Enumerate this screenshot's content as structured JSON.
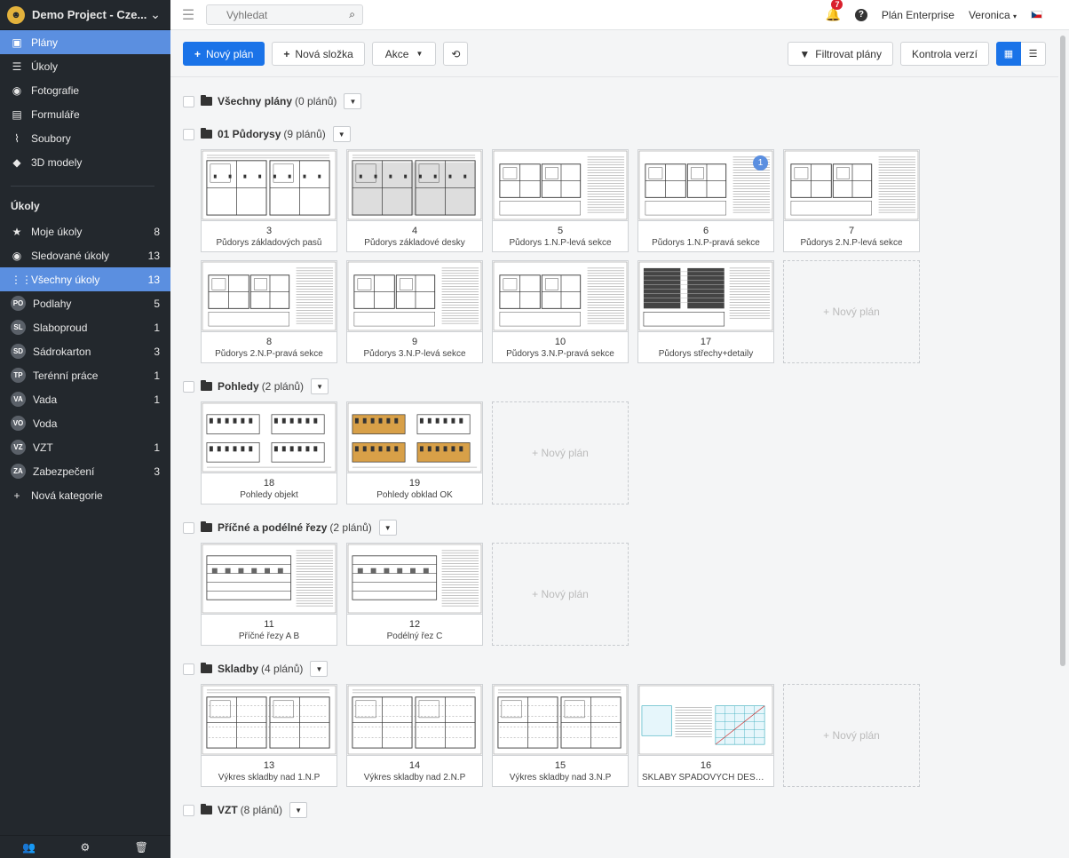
{
  "project": {
    "name": "Demo Project - Cze...",
    "logo_icon": "project-logo-icon"
  },
  "nav": [
    {
      "label": "Plány",
      "icon": "plans-icon",
      "active": true
    },
    {
      "label": "Úkoly",
      "icon": "list-icon"
    },
    {
      "label": "Fotografie",
      "icon": "camera-icon"
    },
    {
      "label": "Formuláře",
      "icon": "clipboard-icon"
    },
    {
      "label": "Soubory",
      "icon": "paperclip-icon"
    },
    {
      "label": "3D modely",
      "icon": "cube-icon"
    }
  ],
  "tasks_section": {
    "title": "Úkoly",
    "items": [
      {
        "label": "Moje úkoly",
        "icon": "star-icon",
        "count": "8"
      },
      {
        "label": "Sledované úkoly",
        "icon": "eye-icon",
        "count": "13"
      },
      {
        "label": "Všechny úkoly",
        "icon": "grid-icon",
        "count": "13",
        "active": true
      },
      {
        "label": "Podlahy",
        "badge": "PO",
        "count": "5"
      },
      {
        "label": "Slaboproud",
        "badge": "SL",
        "count": "1"
      },
      {
        "label": "Sádrokarton",
        "badge": "SD",
        "count": "3"
      },
      {
        "label": "Terénní práce",
        "badge": "TP",
        "count": "1"
      },
      {
        "label": "Vada",
        "badge": "VA",
        "count": "1"
      },
      {
        "label": "Voda",
        "badge": "VO",
        "count": ""
      },
      {
        "label": "VZT",
        "badge": "VZ",
        "count": "1"
      },
      {
        "label": "Zabezpečení",
        "badge": "ZA",
        "count": "3"
      }
    ],
    "new_category": "Nová kategorie"
  },
  "topbar": {
    "search_placeholder": "Vyhledat",
    "notifications": "7",
    "plan": "Plán Enterprise",
    "user": "Veronica"
  },
  "toolbar": {
    "new_plan": "Nový plán",
    "new_folder": "Nová složka",
    "actions": "Akce",
    "filter": "Filtrovat plány",
    "version_check": "Kontrola verzí"
  },
  "new_plan_tile": "+ Nový plán",
  "folders": [
    {
      "name": "Všechny plány",
      "count": "(0 plánů)",
      "plans": [],
      "new_tile": false
    },
    {
      "name": "01 Půdorysy",
      "count": "(9 plánů)",
      "new_tile": true,
      "plans": [
        {
          "num": "3",
          "title": "Půdorys základových pasů",
          "kind": "foundation"
        },
        {
          "num": "4",
          "title": "Půdorys základové desky",
          "kind": "slab"
        },
        {
          "num": "5",
          "title": "Půdorys 1.N.P-levá sekce",
          "kind": "floor"
        },
        {
          "num": "6",
          "title": "Půdorys 1.N.P-pravá sekce",
          "kind": "floor",
          "pin": "1"
        },
        {
          "num": "7",
          "title": "Půdorys 2.N.P-levá sekce",
          "kind": "floor"
        },
        {
          "num": "8",
          "title": "Půdorys 2.N.P-pravá sekce",
          "kind": "floor"
        },
        {
          "num": "9",
          "title": "Půdorys 3.N.P-levá sekce",
          "kind": "floor"
        },
        {
          "num": "10",
          "title": "Půdorys 3.N.P-pravá sekce",
          "kind": "floor"
        },
        {
          "num": "17",
          "title": "Půdorys střechy+detaily",
          "kind": "roof"
        }
      ]
    },
    {
      "name": "Pohledy",
      "count": "(2 plánů)",
      "new_tile": true,
      "plans": [
        {
          "num": "18",
          "title": "Pohledy objekt",
          "kind": "elevation"
        },
        {
          "num": "19",
          "title": "Pohledy obklad OK",
          "kind": "elevation-color"
        }
      ]
    },
    {
      "name": "Příčné a podélné řezy",
      "count": "(2 plánů)",
      "new_tile": true,
      "plans": [
        {
          "num": "11",
          "title": "Příčné řezy A B",
          "kind": "section"
        },
        {
          "num": "12",
          "title": "Podélný řez C",
          "kind": "section"
        }
      ]
    },
    {
      "name": "Skladby",
      "count": "(4 plánů)",
      "new_tile": true,
      "plans": [
        {
          "num": "13",
          "title": "Výkres skladby nad 1.N.P",
          "kind": "layers"
        },
        {
          "num": "14",
          "title": "Výkres skladby nad 2.N.P",
          "kind": "layers"
        },
        {
          "num": "15",
          "title": "Výkres skladby nad 3.N.P",
          "kind": "layers"
        },
        {
          "num": "16",
          "title": "SKLABY SPÁDOVÝCH DESEK...",
          "kind": "grid-detail"
        }
      ]
    },
    {
      "name": "VZT",
      "count": "(8 plánů)",
      "plans": [],
      "new_tile": false
    }
  ]
}
